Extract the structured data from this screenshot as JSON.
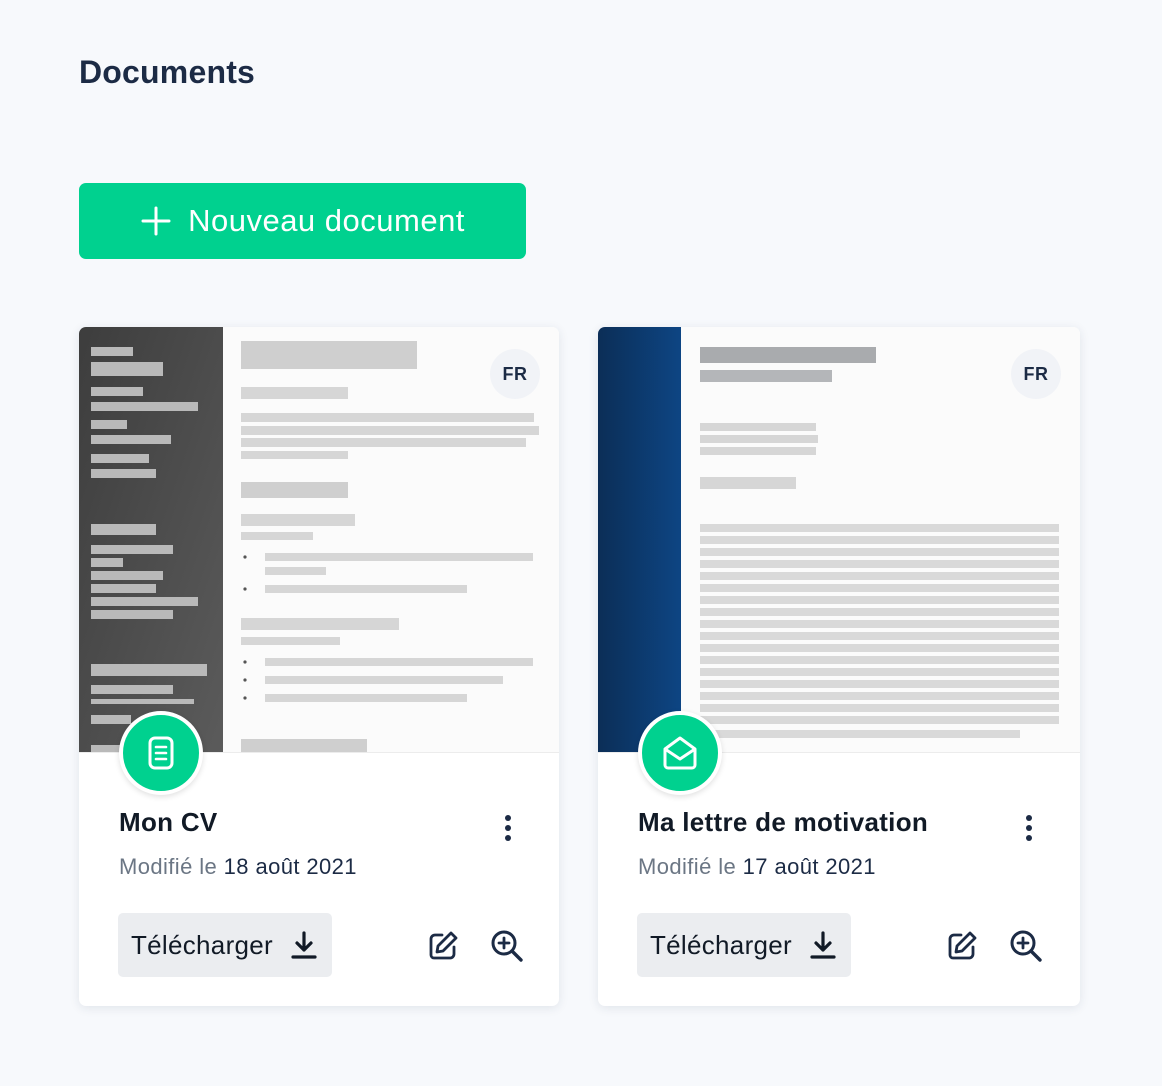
{
  "page": {
    "title": "Documents",
    "new_document_label": "Nouveau document"
  },
  "colors": {
    "accent": "#00d18f",
    "background": "#f7f9fc",
    "title": "#1c2b45"
  },
  "documents": [
    {
      "type": "resume",
      "type_icon": "document-list-icon",
      "language": "FR",
      "title": "Mon CV",
      "modified_prefix": "Modifié le",
      "modified_date": "18 août 2021",
      "download_label": "Télécharger",
      "edit_icon": "edit-icon",
      "preview_icon": "zoom-in-icon"
    },
    {
      "type": "cover-letter",
      "type_icon": "envelope-open-icon",
      "language": "FR",
      "title": "Ma lettre de motivation",
      "modified_prefix": "Modifié le",
      "modified_date": "17 août 2021",
      "download_label": "Télécharger",
      "edit_icon": "edit-icon",
      "preview_icon": "zoom-in-icon"
    }
  ]
}
